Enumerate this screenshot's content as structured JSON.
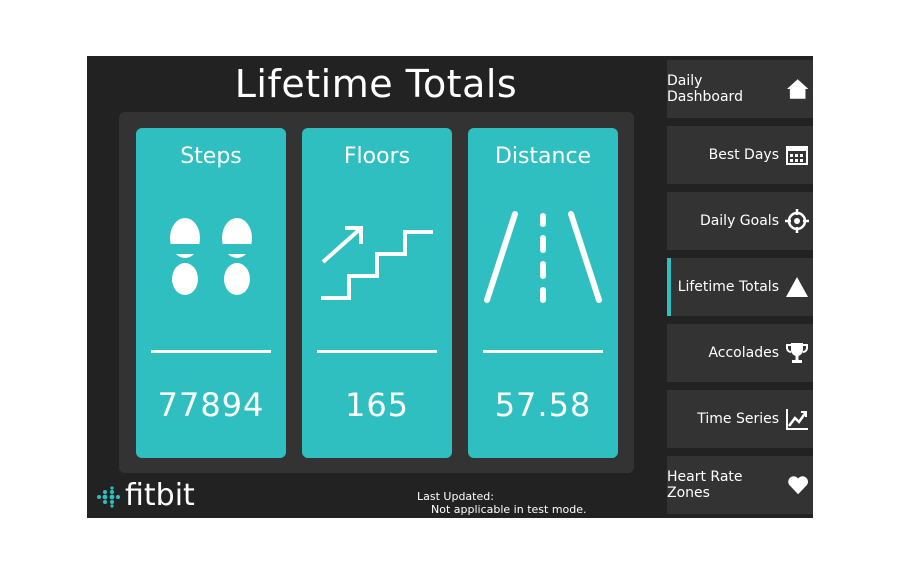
{
  "page": {
    "title": "Lifetime Totals"
  },
  "cards": [
    {
      "label": "Steps",
      "value": "77894",
      "icon": "footprints-icon"
    },
    {
      "label": "Floors",
      "value": "165",
      "icon": "stairs-icon"
    },
    {
      "label": "Distance",
      "value": "57.58",
      "icon": "road-icon"
    }
  ],
  "footer": {
    "brand": "fitbit",
    "updated_label": "Last Updated:",
    "updated_value": "Not applicable in test mode."
  },
  "sidebar": {
    "items": [
      {
        "label": "Daily Dashboard",
        "icon": "home-icon"
      },
      {
        "label": "Best Days",
        "icon": "calendar-icon"
      },
      {
        "label": "Daily Goals",
        "icon": "target-icon"
      },
      {
        "label": "Lifetime Totals",
        "icon": "triangle-icon",
        "active": true
      },
      {
        "label": "Accolades",
        "icon": "trophy-icon"
      },
      {
        "label": "Time Series",
        "icon": "chart-line-icon"
      },
      {
        "label": "Heart Rate Zones",
        "icon": "heart-icon"
      }
    ]
  },
  "colors": {
    "accent": "#30bfc1",
    "background": "#222222",
    "panel": "#333333"
  }
}
